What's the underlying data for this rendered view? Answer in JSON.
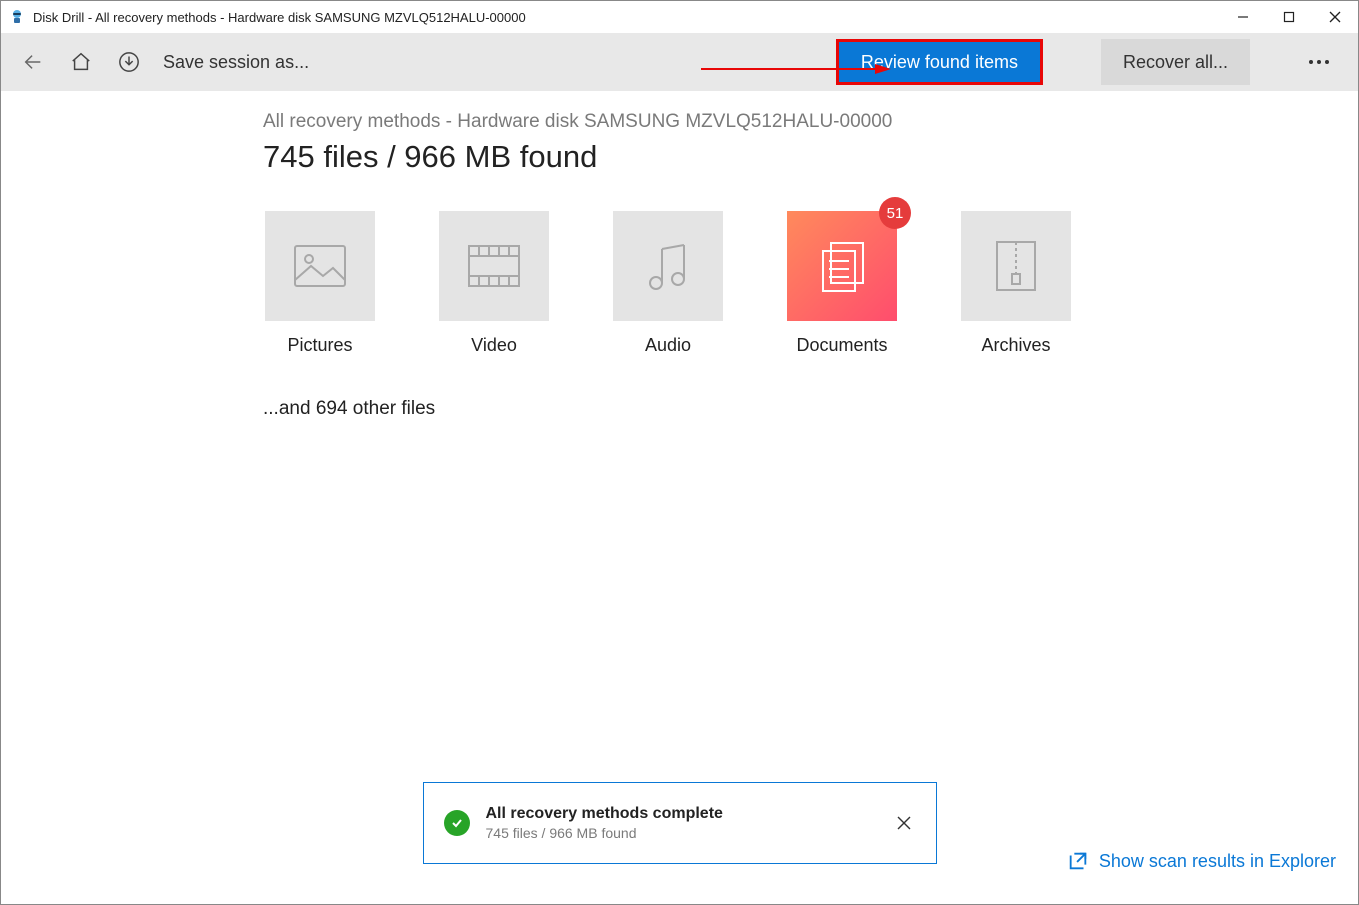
{
  "window": {
    "title": "Disk Drill - All recovery methods - Hardware disk SAMSUNG MZVLQ512HALU-00000"
  },
  "toolbar": {
    "save_session_label": "Save session as...",
    "review_label": "Review found items",
    "recover_label": "Recover all..."
  },
  "main": {
    "breadcrumb": "All recovery methods - Hardware disk SAMSUNG MZVLQ512HALU-00000",
    "headline": "745 files / 966 MB found",
    "other_files_text": "...and 694 other files",
    "categories": [
      {
        "label": "Pictures"
      },
      {
        "label": "Video"
      },
      {
        "label": "Audio"
      },
      {
        "label": "Documents",
        "badge": "51"
      },
      {
        "label": "Archives"
      }
    ]
  },
  "toast": {
    "title": "All recovery methods complete",
    "subtitle": "745 files / 966 MB found"
  },
  "footer": {
    "explorer_link": "Show scan results in Explorer"
  }
}
